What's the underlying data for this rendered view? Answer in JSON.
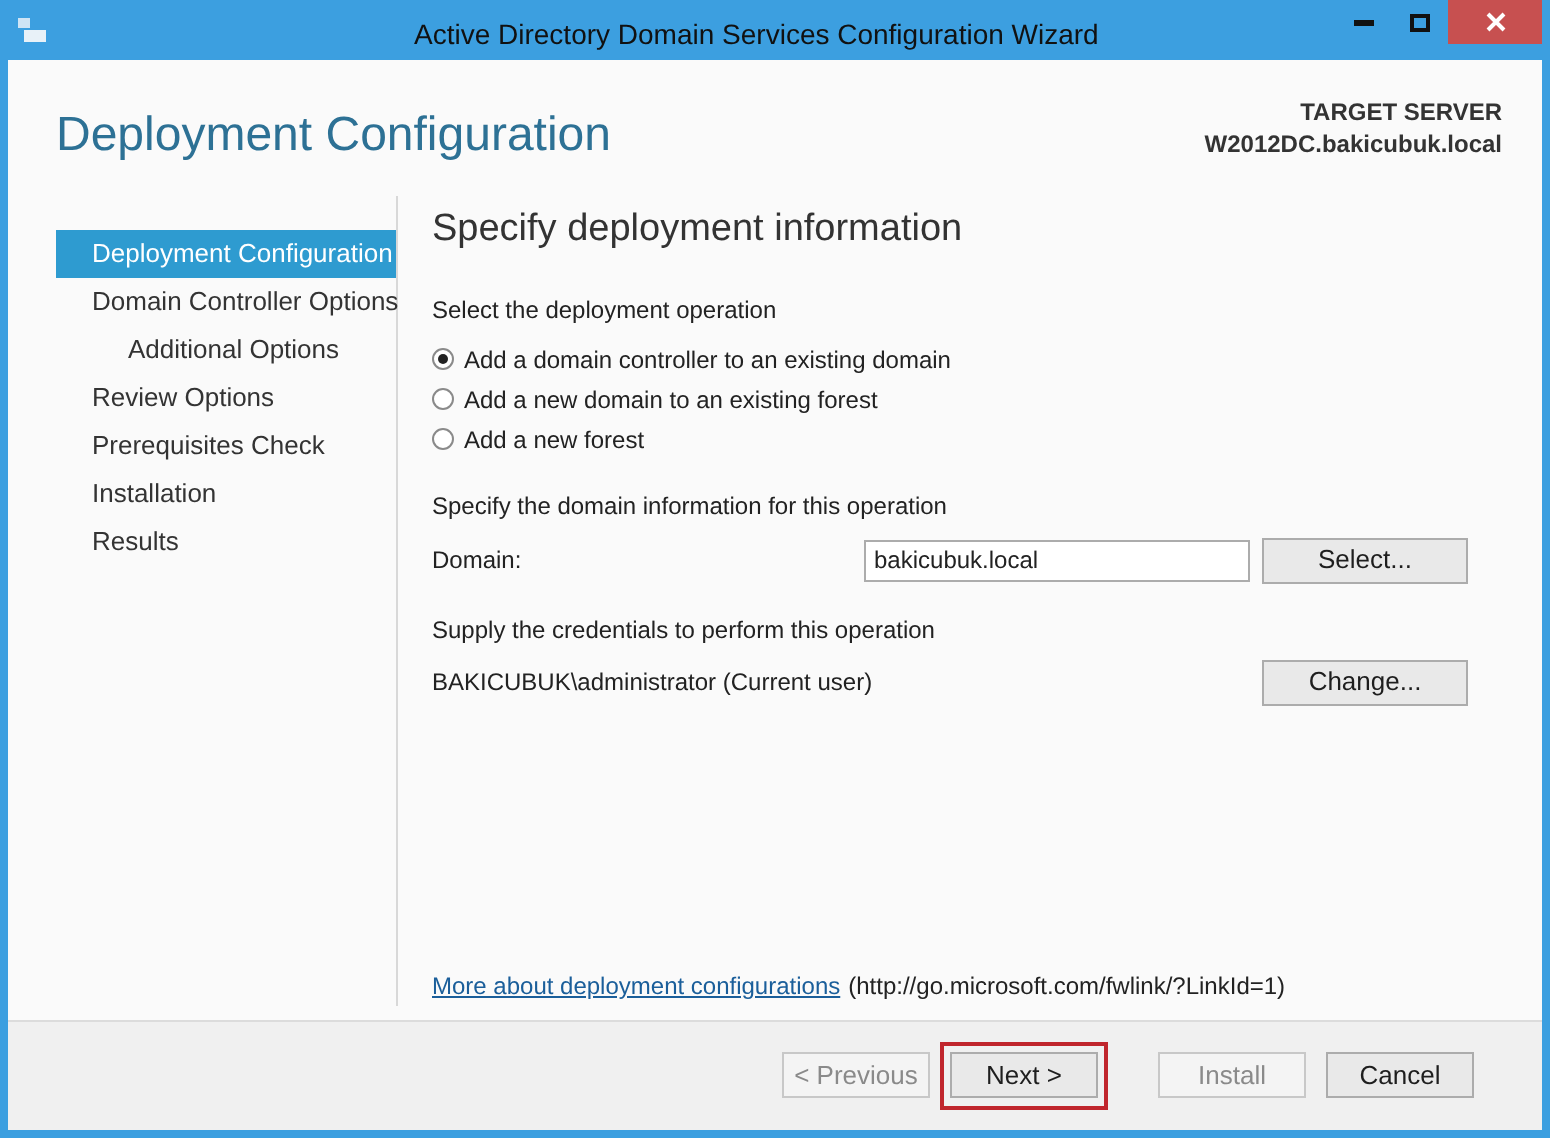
{
  "window": {
    "title": "Active Directory Domain Services Configuration Wizard"
  },
  "page_title": "Deployment Configuration",
  "target_server": {
    "label": "TARGET SERVER",
    "name": "W2012DC.bakicubuk.local"
  },
  "sidebar": {
    "items": [
      {
        "label": "Deployment Configuration",
        "selected": true
      },
      {
        "label": "Domain Controller Options",
        "selected": false,
        "children": [
          {
            "label": "Additional Options",
            "selected": false
          }
        ]
      },
      {
        "label": "Review Options",
        "selected": false
      },
      {
        "label": "Prerequisites Check",
        "selected": false
      },
      {
        "label": "Installation",
        "selected": false
      },
      {
        "label": "Results",
        "selected": false
      }
    ]
  },
  "heading": "Specify deployment information",
  "operation": {
    "label": "Select the deployment operation",
    "options": [
      {
        "label": "Add a domain controller to an existing domain",
        "selected": true
      },
      {
        "label": "Add a new domain to an existing forest",
        "selected": false
      },
      {
        "label": "Add a new forest",
        "selected": false
      }
    ]
  },
  "domain_section": {
    "label": "Specify the domain information for this operation",
    "field_label": "Domain:",
    "value": "bakicubuk.local",
    "button": "Select..."
  },
  "credentials": {
    "label": "Supply the credentials to perform this operation",
    "user": "BAKICUBUK\\administrator (Current user)",
    "button": "Change..."
  },
  "more_link": {
    "text": "More about deployment configurations",
    "url": "(http://go.microsoft.com/fwlink/?LinkId=1)"
  },
  "buttons": [
    {
      "label": "< Previous",
      "disabled": true,
      "highlighted": false
    },
    {
      "label": "Next >",
      "disabled": false,
      "highlighted": true
    },
    {
      "label": "Install",
      "disabled": true,
      "highlighted": false
    },
    {
      "label": "Cancel",
      "disabled": false,
      "highlighted": false
    }
  ]
}
